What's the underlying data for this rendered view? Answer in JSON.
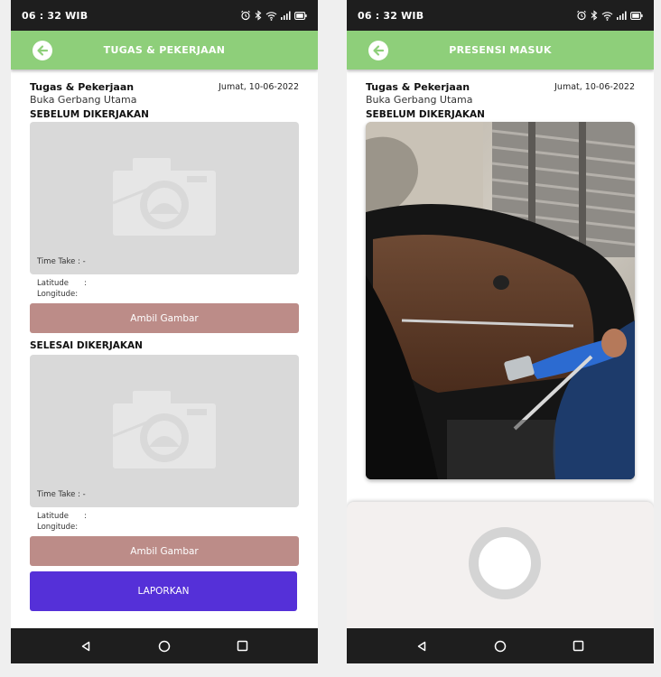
{
  "left_screen": {
    "status": {
      "time": "06 : 32 WIB"
    },
    "appbar": {
      "title": "TUGAS & PEKERJAAN"
    },
    "task": {
      "title": "Tugas & Pekerjaan",
      "subtitle": "Buka Gerbang Utama",
      "date": "Jumat, 10-06-2022"
    },
    "before": {
      "section_title": "SEBELUM DIKERJAKAN",
      "time_take": "Time Take : -",
      "latitude_label": "Latitude",
      "latitude_value": ":",
      "longitude_label": "Longitude",
      "longitude_value": ":",
      "button_label": "Ambil Gambar"
    },
    "after": {
      "section_title": "SELESAI DIKERJAKAN",
      "time_take": "Time Take : -",
      "latitude_label": "Latitude",
      "latitude_value": ":",
      "longitude_label": "Longitude",
      "longitude_value": ":",
      "button_label": "Ambil Gambar"
    },
    "report_button": "LAPORKAN"
  },
  "right_screen": {
    "status": {
      "time": "06 : 32 WIB"
    },
    "appbar": {
      "title": "PRESENSI MASUK"
    },
    "task": {
      "title": "Tugas & Pekerjaan",
      "subtitle": "Buka Gerbang Utama",
      "date": "Jumat, 10-06-2022"
    },
    "section_title": "SEBELUM DIKERJAKAN"
  },
  "icons": {
    "status": [
      "alarm-icon",
      "bluetooth-icon",
      "wifi-icon",
      "signal-icon",
      "battery-icon"
    ],
    "back": "back-arrow-icon",
    "placeholder": "camera-icon",
    "nav": [
      "back-triangle-icon",
      "home-circle-icon",
      "recents-square-icon"
    ]
  },
  "colors": {
    "appbar": "#8ecf7a",
    "ambil_button": "#bc8c88",
    "report_button": "#5530d8",
    "system_bars": "#1e1e1e",
    "placeholder": "#d9d9d9"
  }
}
